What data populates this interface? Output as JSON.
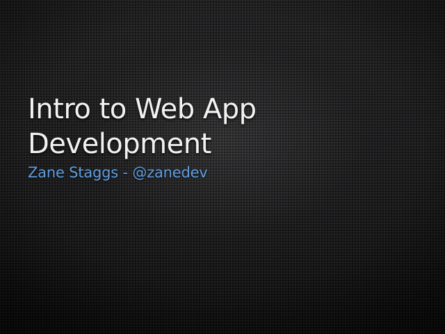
{
  "slide": {
    "title": "Intro to Web App Development",
    "subtitle": "Zane Staggs - @zanedev"
  },
  "colors": {
    "background": "#151516",
    "title": "#f2f2f2",
    "subtitle": "#5f9ee0"
  }
}
